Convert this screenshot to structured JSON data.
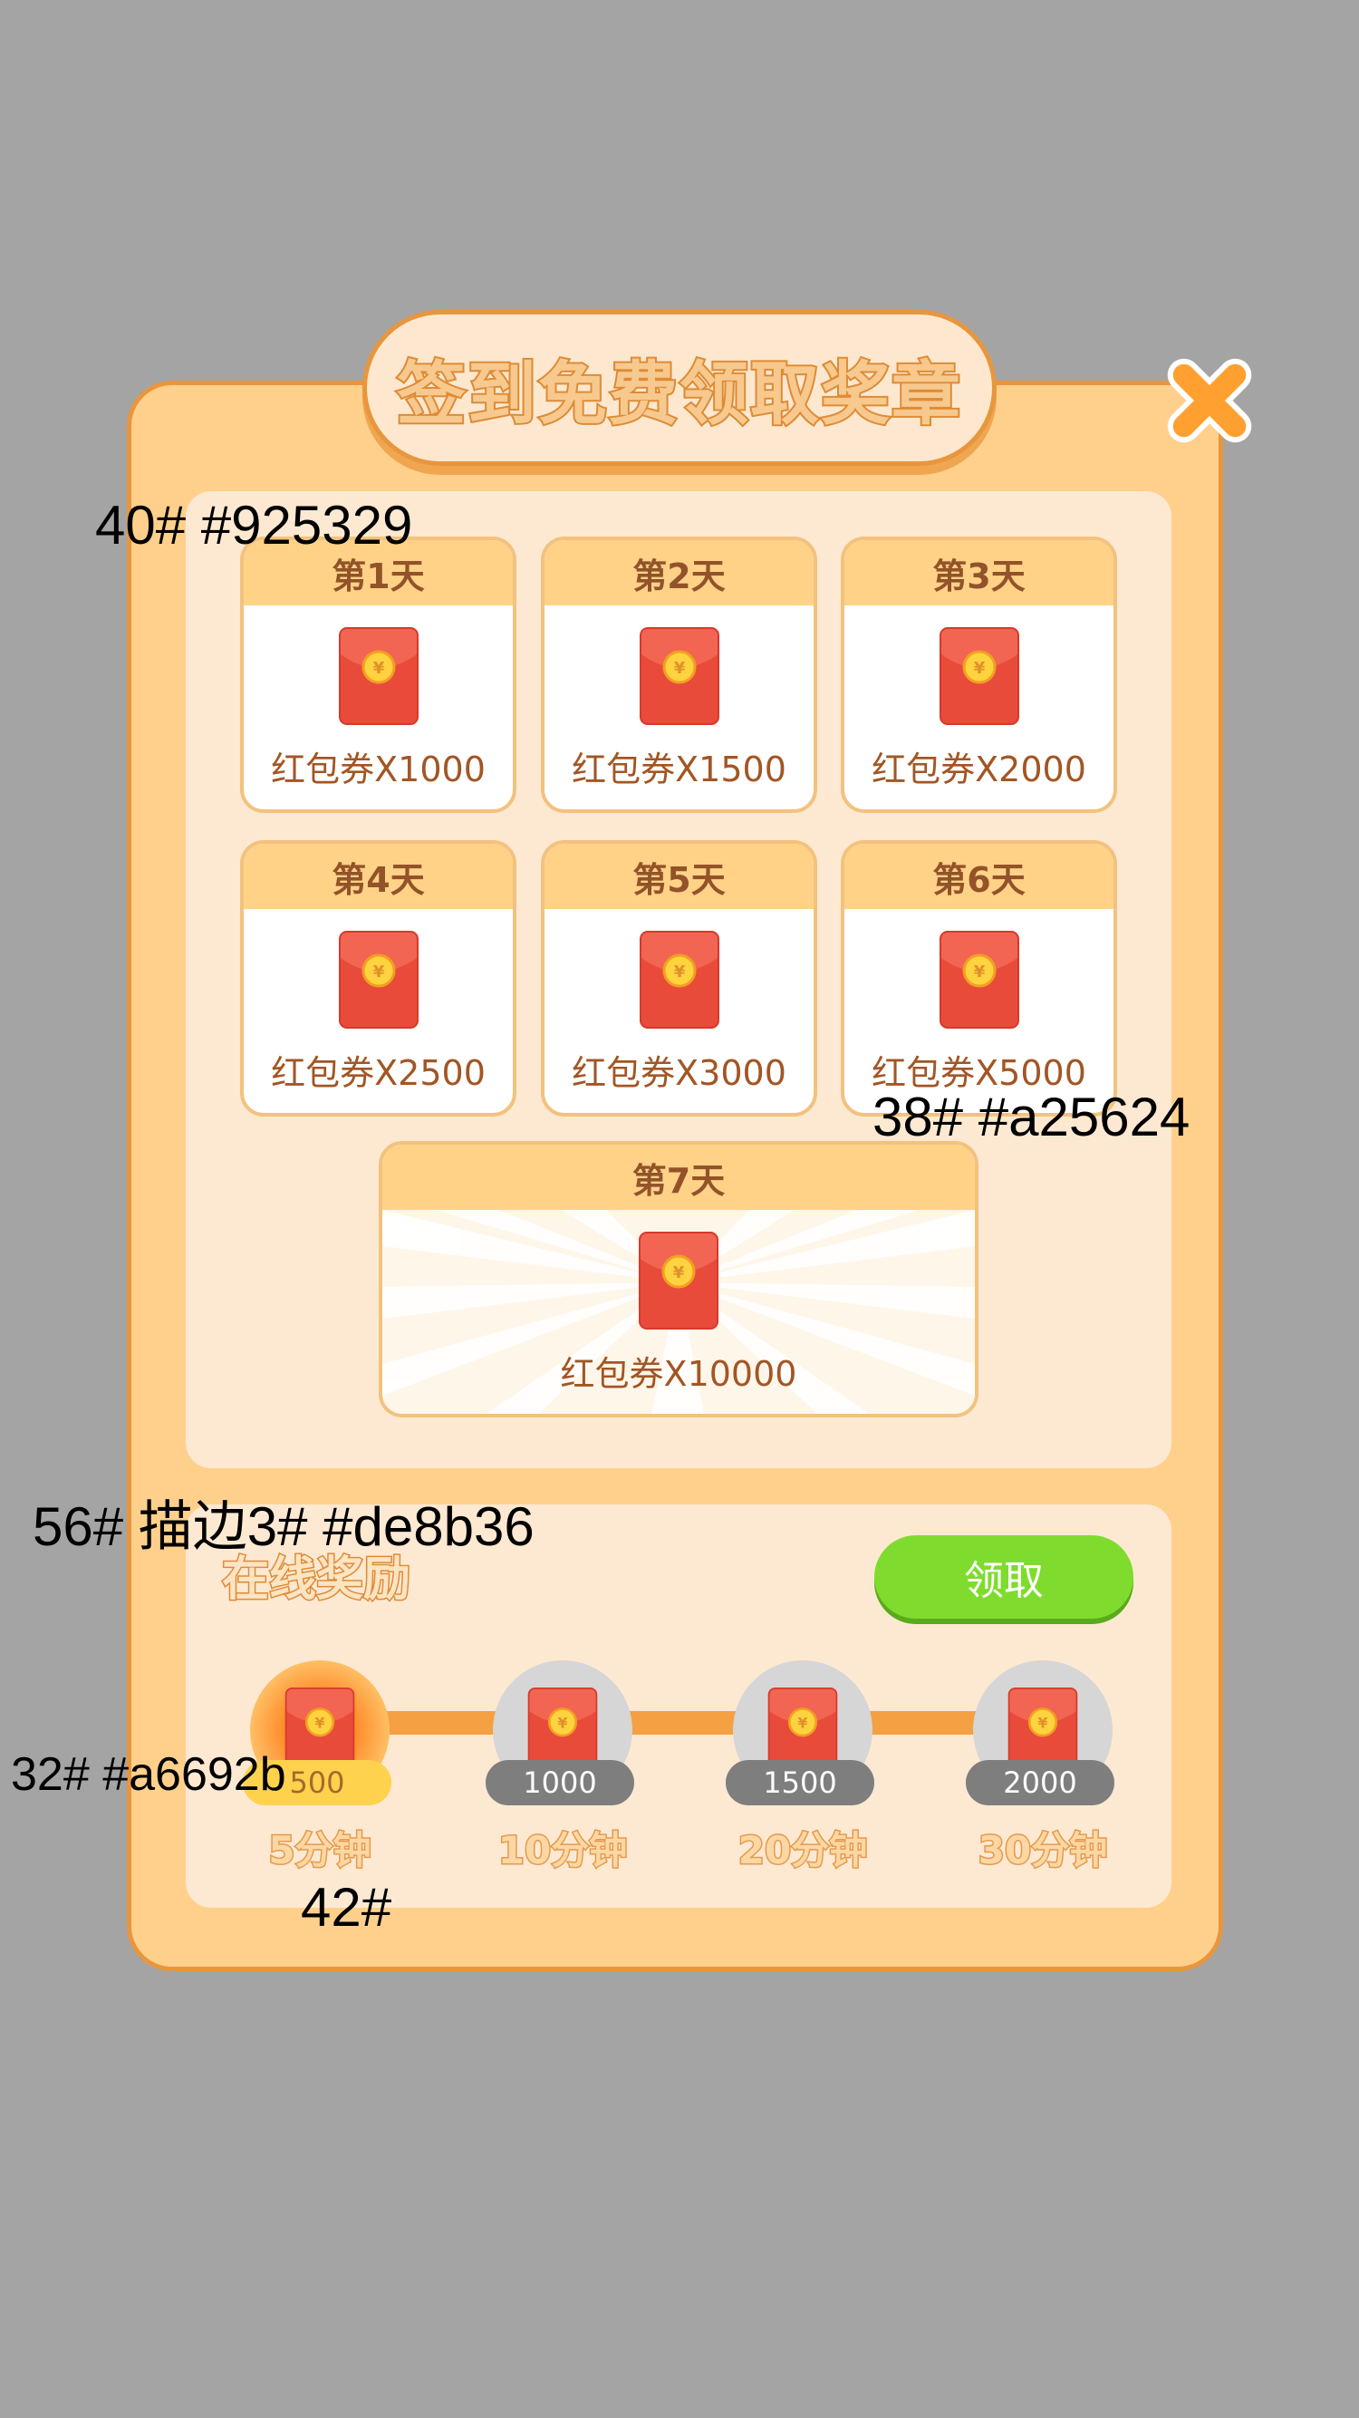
{
  "title": "签到免费领取奖章",
  "close_icon": "close-x-icon",
  "days": [
    {
      "label": "第1天",
      "reward": "红包券X1000"
    },
    {
      "label": "第2天",
      "reward": "红包券X1500"
    },
    {
      "label": "第3天",
      "reward": "红包券X2000"
    },
    {
      "label": "第4天",
      "reward": "红包券X2500"
    },
    {
      "label": "第5天",
      "reward": "红包券X3000"
    },
    {
      "label": "第6天",
      "reward": "红包券X5000"
    },
    {
      "label": "第7天",
      "reward": "红包券X10000"
    }
  ],
  "online": {
    "title": "在线奖励",
    "claim_label": "领取",
    "nodes": [
      {
        "amount": "500",
        "time": "5分钟",
        "active": true
      },
      {
        "amount": "1000",
        "time": "10分钟",
        "active": false
      },
      {
        "amount": "1500",
        "time": "20分钟",
        "active": false
      },
      {
        "amount": "2000",
        "time": "30分钟",
        "active": false
      }
    ]
  },
  "annotations": {
    "day_header_spec": "40# #925329",
    "reward_text_spec": "38# #a25624",
    "online_title_spec": "56# 描边3# #de8b36",
    "badge_spec": "32# #a6692b",
    "time_spec": "42#"
  },
  "colors": {
    "panel": "#ffd08c",
    "border": "#e8963e",
    "day_header_text": "#925329",
    "reward_text": "#a25624",
    "stroke": "#de8b36",
    "claim_button": "#7fdc2e",
    "envelope": "#ea4e3d"
  }
}
